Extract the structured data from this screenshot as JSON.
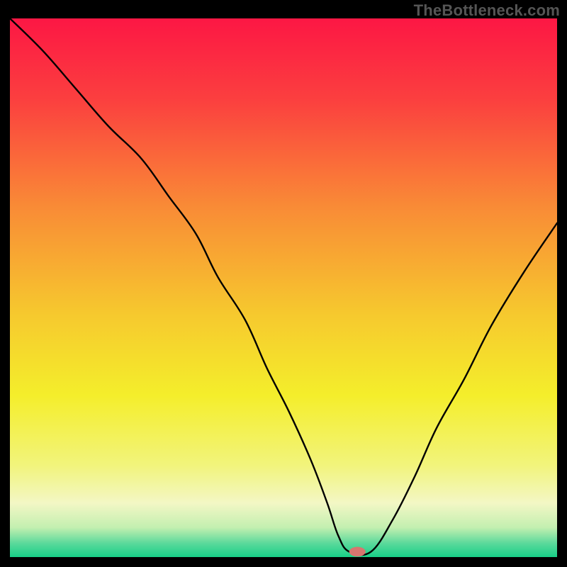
{
  "watermark": "TheBottleneck.com",
  "chart_data": {
    "type": "line",
    "title": "",
    "xlabel": "",
    "ylabel": "",
    "xlim": [
      0,
      100
    ],
    "ylim": [
      0,
      100
    ],
    "grid": false,
    "legend": false,
    "background_gradient": {
      "type": "vertical",
      "stops": [
        {
          "pos": 0.0,
          "color": "#fc1744"
        },
        {
          "pos": 0.15,
          "color": "#fb3f3f"
        },
        {
          "pos": 0.35,
          "color": "#f98b36"
        },
        {
          "pos": 0.55,
          "color": "#f6c92e"
        },
        {
          "pos": 0.7,
          "color": "#f4ee2b"
        },
        {
          "pos": 0.83,
          "color": "#f2f47c"
        },
        {
          "pos": 0.9,
          "color": "#f3f7c5"
        },
        {
          "pos": 0.945,
          "color": "#c3efb0"
        },
        {
          "pos": 0.975,
          "color": "#59d99b"
        },
        {
          "pos": 1.0,
          "color": "#17cf87"
        }
      ]
    },
    "series": [
      {
        "name": "bottleneck-curve",
        "x": [
          0,
          6,
          12,
          18,
          24,
          29,
          34,
          38,
          43,
          47,
          51,
          55,
          58,
          60,
          62,
          66,
          70,
          74,
          78,
          83,
          88,
          94,
          100
        ],
        "y": [
          100,
          94,
          87,
          80,
          74,
          67,
          60,
          52,
          44,
          35,
          27,
          18,
          10,
          4,
          1,
          1,
          7,
          15,
          24,
          33,
          43,
          53,
          62
        ]
      }
    ],
    "marker": {
      "name": "optimal-point",
      "x": 63.5,
      "y": 1.0,
      "rx": 1.5,
      "ry": 0.9,
      "color": "#d8756f"
    }
  }
}
